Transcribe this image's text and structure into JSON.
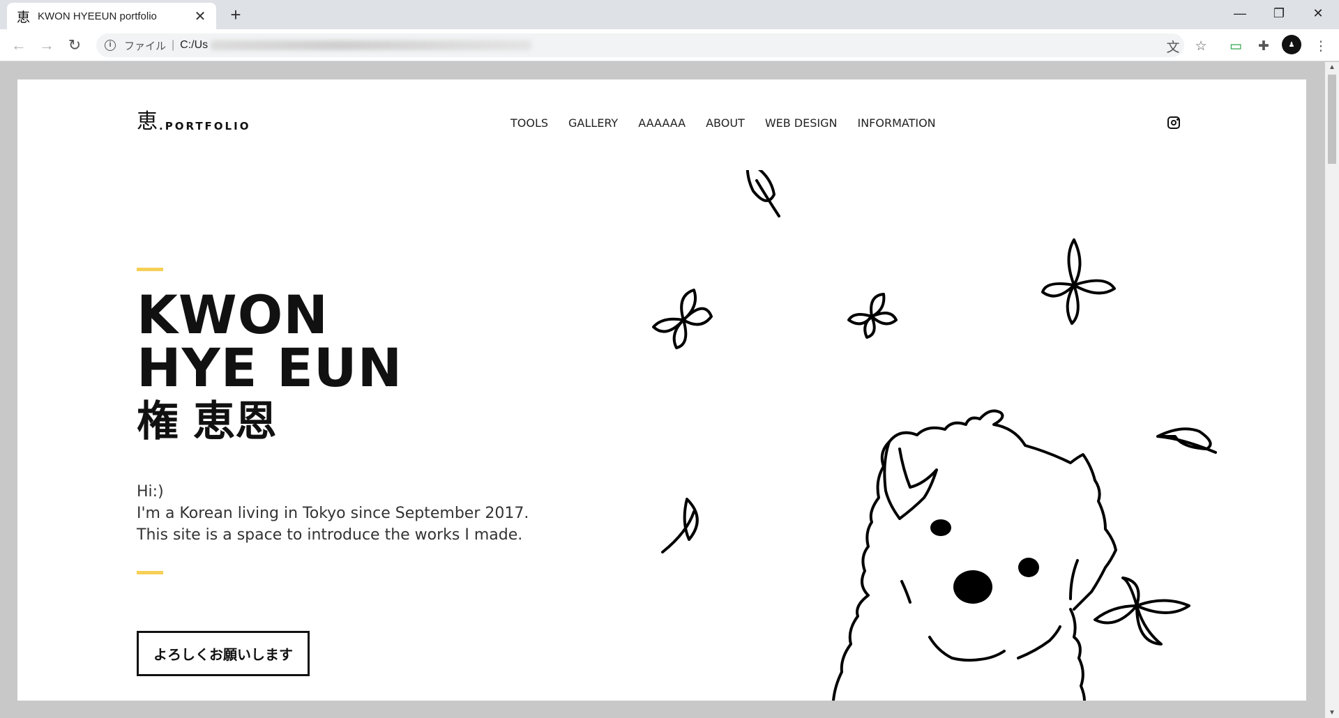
{
  "browser": {
    "tab": {
      "favicon": "恵",
      "title": "KWON HYEEUN portfolio"
    },
    "address": {
      "scheme_label": "ファイル",
      "url_visible": "C:/Us"
    }
  },
  "site": {
    "logo": {
      "kanji": "恵",
      "text": ".PORTFOLIO"
    },
    "nav": [
      "TOOLS",
      "GALLERY",
      "AAAAAA",
      "ABOUT",
      "WEB DESIGN",
      "INFORMATION"
    ],
    "hero": {
      "title_line1": "KWON",
      "title_line2": "HYE EUN",
      "title_kanji": "権 恵恩",
      "intro": [
        "Hi:)",
        "I'm a Korean living in Tokyo since September 2017.",
        "This site is a space to introduce the works I made."
      ],
      "cta_label": "よろしくお願いします"
    },
    "colors": {
      "accent": "#f6cf57",
      "text": "#111111"
    }
  }
}
